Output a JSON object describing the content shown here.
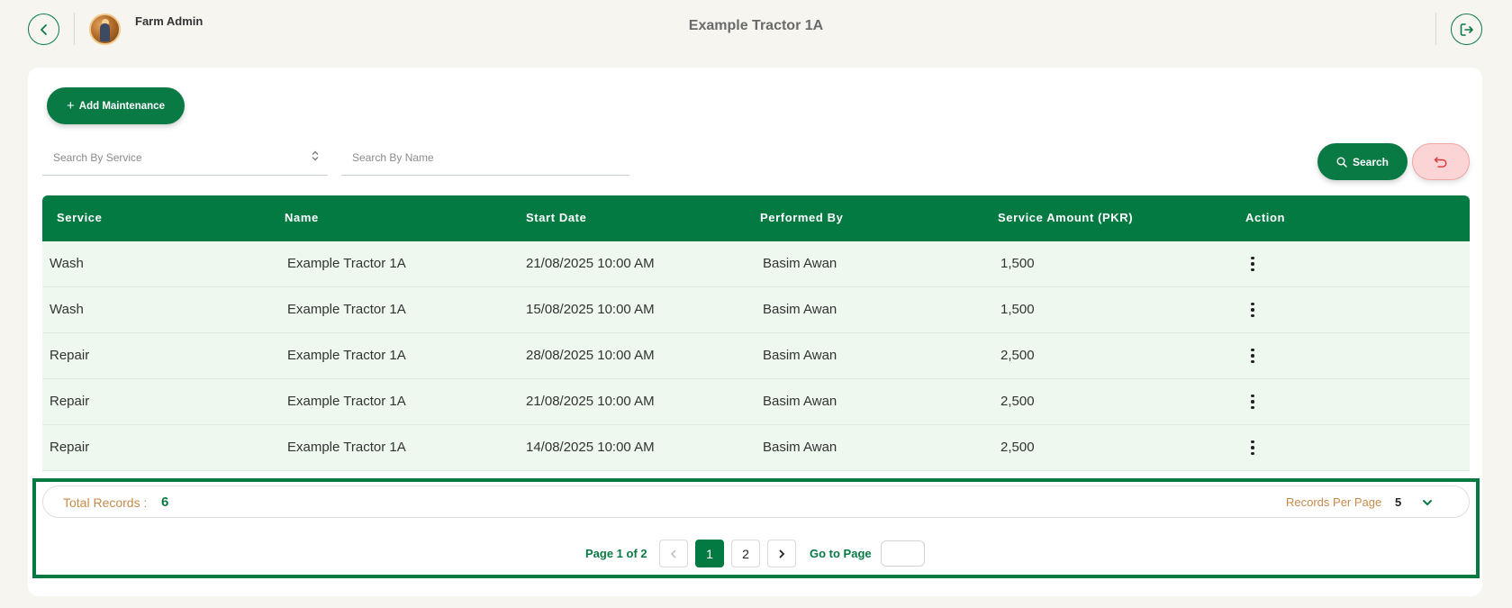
{
  "header": {
    "user_name": "Farm Admin",
    "page_title": "Example Tractor 1A"
  },
  "toolbar": {
    "add_label": "Add Maintenance",
    "search_label": "Search"
  },
  "filters": {
    "service_placeholder": "Search By Service",
    "name_placeholder": "Search By Name"
  },
  "table": {
    "headers": [
      "Service",
      "Name",
      "Start Date",
      "Performed By",
      "Service Amount (PKR)",
      "Action"
    ],
    "rows": [
      {
        "service": "Wash",
        "name": "Example Tractor 1A",
        "start_date": "21/08/2025 10:00 AM",
        "performed_by": "Basim Awan",
        "amount": "1,500"
      },
      {
        "service": "Wash",
        "name": "Example Tractor 1A",
        "start_date": "15/08/2025 10:00 AM",
        "performed_by": "Basim Awan",
        "amount": "1,500"
      },
      {
        "service": "Repair",
        "name": "Example Tractor 1A",
        "start_date": "28/08/2025 10:00 AM",
        "performed_by": "Basim Awan",
        "amount": "2,500"
      },
      {
        "service": "Repair",
        "name": "Example Tractor 1A",
        "start_date": "21/08/2025 10:00 AM",
        "performed_by": "Basim Awan",
        "amount": "2,500"
      },
      {
        "service": "Repair",
        "name": "Example Tractor 1A",
        "start_date": "14/08/2025 10:00 AM",
        "performed_by": "Basim Awan",
        "amount": "2,500"
      }
    ]
  },
  "footer": {
    "total_label": "Total Records :",
    "total_value": "6",
    "rpp_label": "Records Per Page",
    "rpp_value": "5",
    "page_info": "Page 1 of 2",
    "pages": [
      "1",
      "2"
    ],
    "goto_label": "Go to Page"
  },
  "colors": {
    "primary": "#047a43",
    "row_bg": "#eef8ef",
    "accent_label": "#c88a4a",
    "reset_bg": "#fbd5d5"
  },
  "icons": {
    "back": "chevron-left-icon",
    "logout": "logout-icon",
    "add": "plus-icon",
    "search": "search-icon",
    "reset": "undo-icon",
    "row_action": "kebab-icon"
  }
}
